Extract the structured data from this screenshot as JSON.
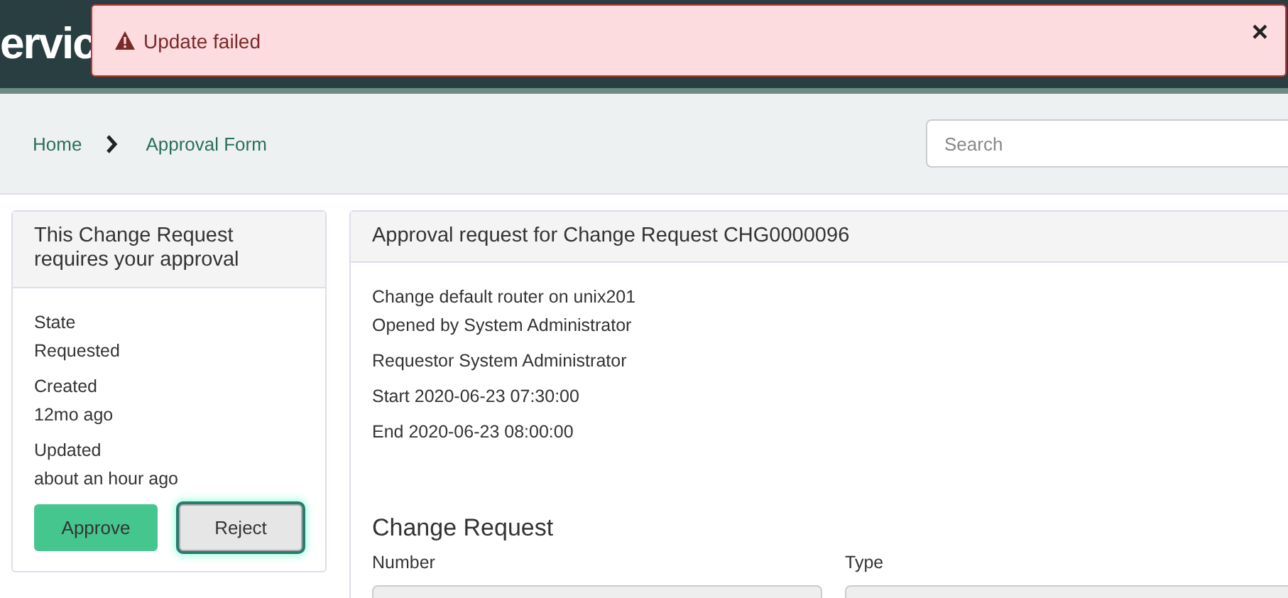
{
  "header": {
    "logo_text": "ervic"
  },
  "alert": {
    "message": "Update failed",
    "close": "×"
  },
  "breadcrumb": [
    {
      "label": "Home"
    },
    {
      "label": "Approval Form"
    }
  ],
  "search": {
    "placeholder": "Search"
  },
  "approval_card": {
    "title": "This Change Request requires your approval",
    "fields": [
      {
        "label": "State",
        "value": "Requested"
      },
      {
        "label": "Created",
        "value": "12mo ago"
      },
      {
        "label": "Updated",
        "value": "about an hour ago"
      }
    ],
    "buttons": [
      {
        "label": "Approve",
        "kind": "primary",
        "focused": false
      },
      {
        "label": "Reject",
        "kind": "default",
        "focused": true
      }
    ]
  },
  "request_panel": {
    "title": "Approval request for Change Request CHG0000096",
    "lines": [
      "Change default router on unix201",
      "Opened by System Administrator",
      "Requestor System Administrator",
      "Start 2020-06-23 07:30:00",
      "End 2020-06-23 08:00:00"
    ],
    "section_title": "Change Request",
    "form_fields": [
      {
        "label": "Number"
      },
      {
        "label": "Type"
      }
    ]
  }
}
